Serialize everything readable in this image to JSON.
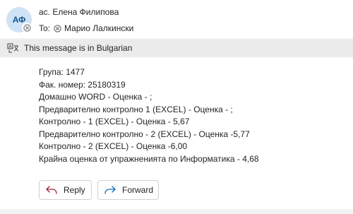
{
  "header": {
    "avatar_initials": "АФ",
    "sender": "ас. Елена Филипова",
    "to_label": "To:",
    "recipient": "Марио Лалкински"
  },
  "translation": {
    "text": "This message is in Bulgarian"
  },
  "body": {
    "lines": [
      "Група: 1477",
      "Фак. номер: 25180319",
      "Домашно WORD - Оценка - ;",
      "Предварително контролно 1 (EXCEL) - Оценка - ;",
      "Контролно - 1 (EXCEL) - Оценка - 5,67",
      "Предварително контролно - 2 (EXCEL) - Оценка -5,77",
      "Контролно - 2 (EXCEL) - Оценка -6,00",
      "Крайна оценка от упражненията по Информатика - 4,68"
    ]
  },
  "actions": {
    "reply": "Reply",
    "forward": "Forward"
  },
  "colors": {
    "avatar_bg": "#cfe2f6",
    "avatar_text": "#0f548c",
    "accent_blue": "#0f6cbd",
    "reply_icon": "#a3213d"
  }
}
